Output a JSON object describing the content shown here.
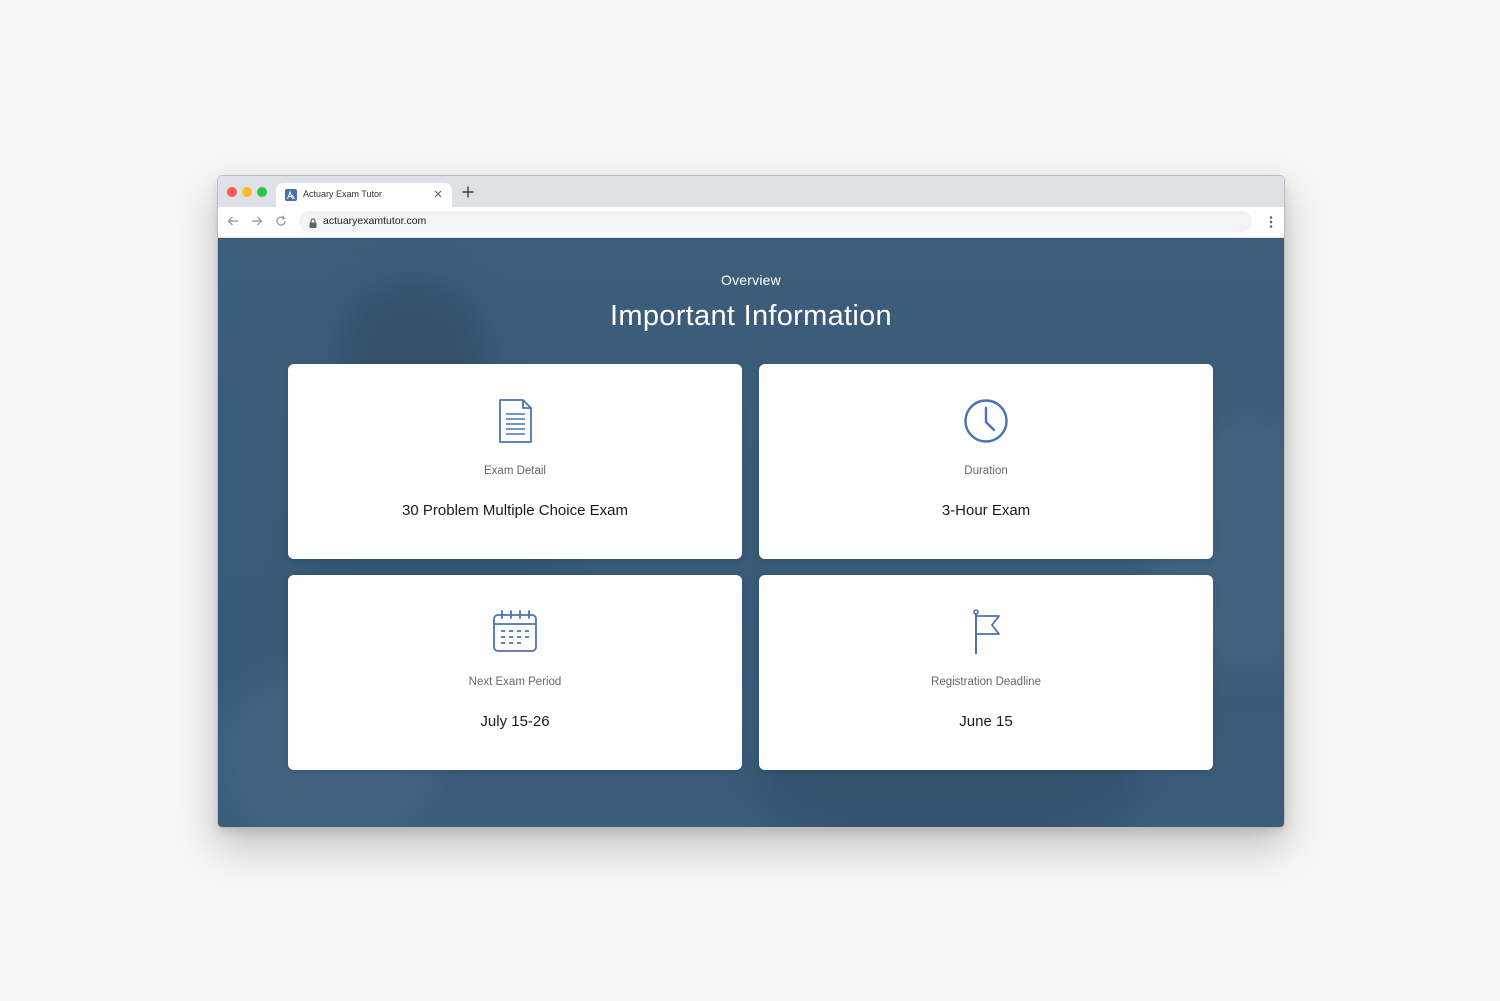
{
  "browser": {
    "tab_title": "Actuary Exam Tutor",
    "url": "actuaryexamtutor.com"
  },
  "colors": {
    "accent": "#4a72b5",
    "background": "#3d5e7b"
  },
  "hero": {
    "overline": "Overview",
    "heading": "Important Information"
  },
  "cards": [
    {
      "icon": "document-icon",
      "label": "Exam Detail",
      "value": "30 Problem Multiple Choice Exam"
    },
    {
      "icon": "clock-icon",
      "label": "Duration",
      "value": "3-Hour Exam"
    },
    {
      "icon": "calendar-icon",
      "label": "Next Exam Period",
      "value": "July 15-26"
    },
    {
      "icon": "flag-icon",
      "label": "Registration Deadline",
      "value": "June 15"
    }
  ]
}
